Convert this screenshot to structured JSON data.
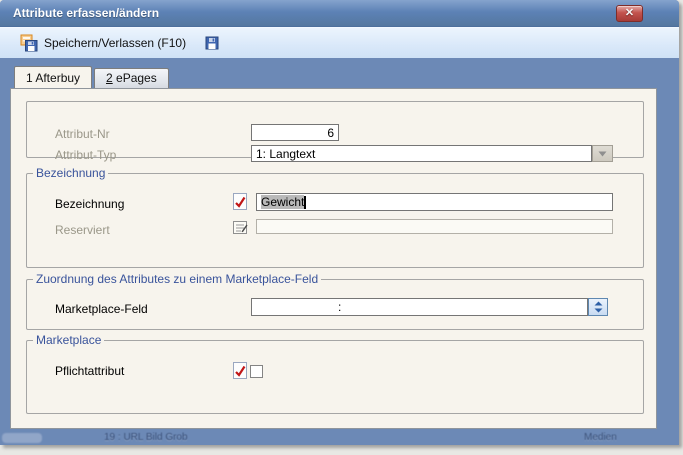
{
  "window": {
    "title": "Attribute erfassen/ändern"
  },
  "toolbar": {
    "save_exit": "Speichern/Verlassen (F10)"
  },
  "tabs": {
    "afterbuy": {
      "label": "1 Afterbuy"
    },
    "epages": {
      "accel": "2",
      "rest": " ePages"
    }
  },
  "form": {
    "attribut_nr": {
      "label": "Attribut-Nr",
      "value": "6"
    },
    "attribut_typ": {
      "label": "Attribut-Typ",
      "value": "1: Langtext"
    },
    "bezeichnung_group": "Bezeichnung",
    "bezeichnung": {
      "label": "Bezeichnung",
      "value": "Gewicht"
    },
    "reserviert": {
      "label": "Reserviert",
      "value": ""
    },
    "zuordnung_group": "Zuordnung des Attributes zu einem Marketplace-Feld",
    "marketplace_feld": {
      "label": "Marketplace-Feld",
      "value": ":"
    },
    "marketplace_group": "Marketplace",
    "pflichtattribut": {
      "label": "Pflichtattribut",
      "checked": false
    }
  },
  "background_window": {
    "row_left": "19 : URL Bild Grob",
    "row_right": "Medien"
  },
  "colors": {
    "titlebar_blue": "#5d82b6",
    "frame_blue": "#6c89b6",
    "panel_cream": "#f7f4ed",
    "toolbar_blue": "#d9e8f9",
    "group_title_blue": "#39539b",
    "close_red": "#c3534e",
    "selection_gray": "#b9b9b9"
  }
}
